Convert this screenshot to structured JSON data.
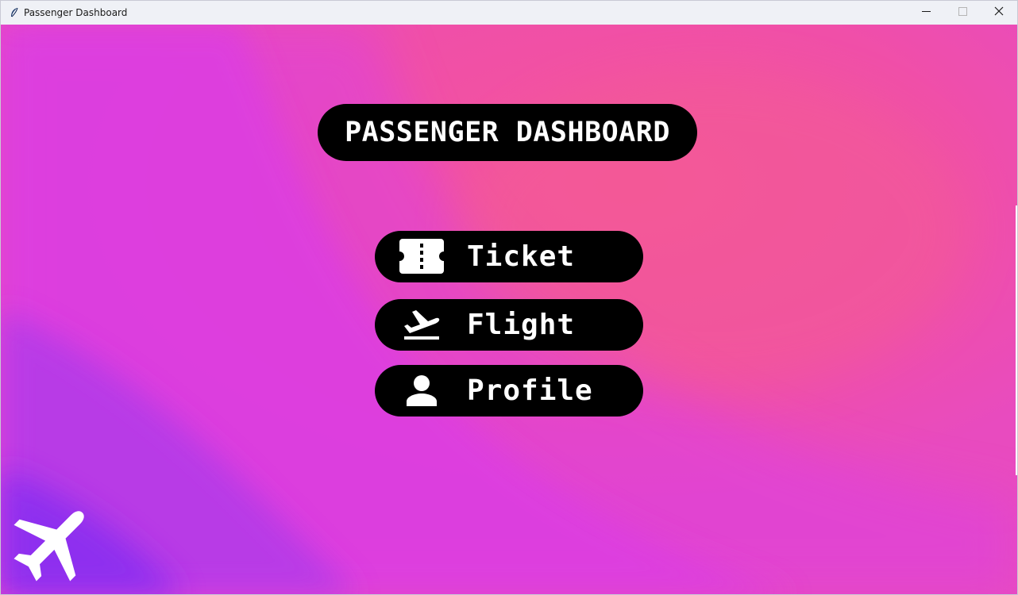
{
  "window": {
    "title": "Passenger Dashboard",
    "controls": [
      "minimize-icon",
      "maximize-icon",
      "close-icon"
    ]
  },
  "dashboard": {
    "heading": "PASSENGER DASHBOARD",
    "buttons": [
      {
        "id": "ticket",
        "label": "Ticket",
        "icon": "ticket-icon"
      },
      {
        "id": "flight",
        "label": "Flight",
        "icon": "flight-takeoff-icon"
      },
      {
        "id": "profile",
        "label": "Profile",
        "icon": "person-icon"
      }
    ],
    "corner_icon": "airplane-icon"
  },
  "colors": {
    "pink": "#f4559b",
    "magenta": "#dd3fe0",
    "purple": "#8a2ff0",
    "pill": "#000000",
    "text": "#ffffff"
  }
}
